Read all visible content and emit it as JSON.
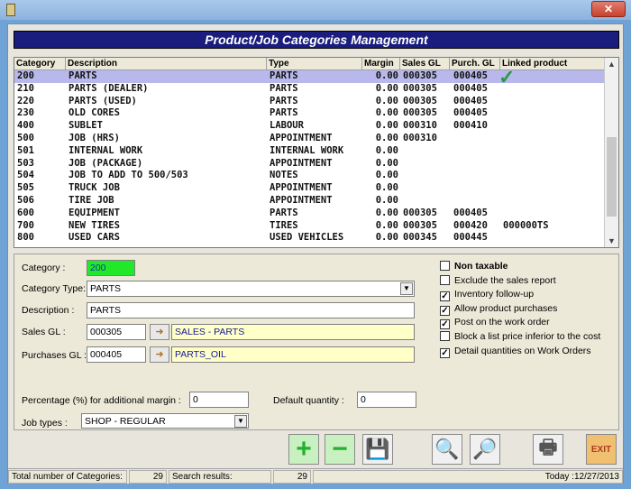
{
  "window": {
    "close": "✕"
  },
  "title": "Product/Job Categories Management",
  "grid": {
    "columns": [
      "Category",
      "Description",
      "Type",
      "Margin",
      "Sales GL",
      "Purch. GL",
      "Linked product"
    ],
    "rows": [
      [
        "200",
        "PARTS",
        "PARTS",
        "0.00",
        "000305",
        "000405",
        ""
      ],
      [
        "210",
        "PARTS (DEALER)",
        "PARTS",
        "0.00",
        "000305",
        "000405",
        ""
      ],
      [
        "220",
        "PARTS (USED)",
        "PARTS",
        "0.00",
        "000305",
        "000405",
        ""
      ],
      [
        "230",
        "OLD CORES",
        "PARTS",
        "0.00",
        "000305",
        "000405",
        ""
      ],
      [
        "400",
        "SUBLET",
        "LABOUR",
        "0.00",
        "000310",
        "000410",
        ""
      ],
      [
        "500",
        "JOB (HRS)",
        "APPOINTMENT",
        "0.00",
        "000310",
        "",
        ""
      ],
      [
        "501",
        "INTERNAL WORK",
        "INTERNAL WORK",
        "0.00",
        "",
        "",
        ""
      ],
      [
        "503",
        "JOB (PACKAGE)",
        "APPOINTMENT",
        "0.00",
        "",
        "",
        ""
      ],
      [
        "504",
        "JOB TO ADD TO 500/503",
        "NOTES",
        "0.00",
        "",
        "",
        ""
      ],
      [
        "505",
        "TRUCK JOB",
        "APPOINTMENT",
        "0.00",
        "",
        "",
        ""
      ],
      [
        "506",
        "TIRE JOB",
        "APPOINTMENT",
        "0.00",
        "",
        "",
        ""
      ],
      [
        "600",
        "EQUIPMENT",
        "PARTS",
        "0.00",
        "000305",
        "000405",
        ""
      ],
      [
        "700",
        "NEW TIRES",
        "TIRES",
        "0.00",
        "000305",
        "000420",
        "000000TS"
      ],
      [
        "800",
        "USED CARS",
        "USED VEHICLES",
        "0.00",
        "000345",
        "000445",
        ""
      ]
    ],
    "selected_row": 0
  },
  "form": {
    "category_label": "Category :",
    "category_value": "200",
    "category_type_label": "Category Type:",
    "category_type_value": "PARTS",
    "description_label": "Description :",
    "description_value": "PARTS",
    "sales_gl_label": "Sales GL :",
    "sales_gl_value": "000305",
    "sales_gl_name": "SALES - PARTS",
    "purchases_gl_label": "Purchases GL :",
    "purchases_gl_value": "000405",
    "purchases_gl_name": "PARTS_OIL",
    "margin_label": "Percentage (%) for additional margin :",
    "margin_value": "0",
    "default_qty_label": "Default quantity :",
    "default_qty_value": "0",
    "job_types_label": "Job types :",
    "job_types_value": "SHOP - REGULAR"
  },
  "options": [
    {
      "label": "Non taxable",
      "checked": false,
      "bold": true
    },
    {
      "label": "Exclude the sales report",
      "checked": false,
      "bold": false
    },
    {
      "label": "Inventory follow-up",
      "checked": true,
      "bold": false
    },
    {
      "label": "Allow product purchases",
      "checked": true,
      "bold": false
    },
    {
      "label": "Post on the work order",
      "checked": true,
      "bold": false
    },
    {
      "label": "Block a list price inferior to the cost",
      "checked": false,
      "bold": false
    },
    {
      "label": "Detail quantities on Work Orders",
      "checked": true,
      "bold": false
    }
  ],
  "toolbar": {
    "add_icon": "+",
    "remove_icon": "−",
    "save_icon": "💾",
    "find_icon": "🔍",
    "search_icon": "🔎",
    "print_icon": "🖶",
    "exit_icon": "EXIT"
  },
  "status": {
    "total_label": "Total number of Categories:",
    "total_value": "29",
    "search_label": "Search results:",
    "search_value": "29",
    "today": "Today :12/27/2013"
  }
}
